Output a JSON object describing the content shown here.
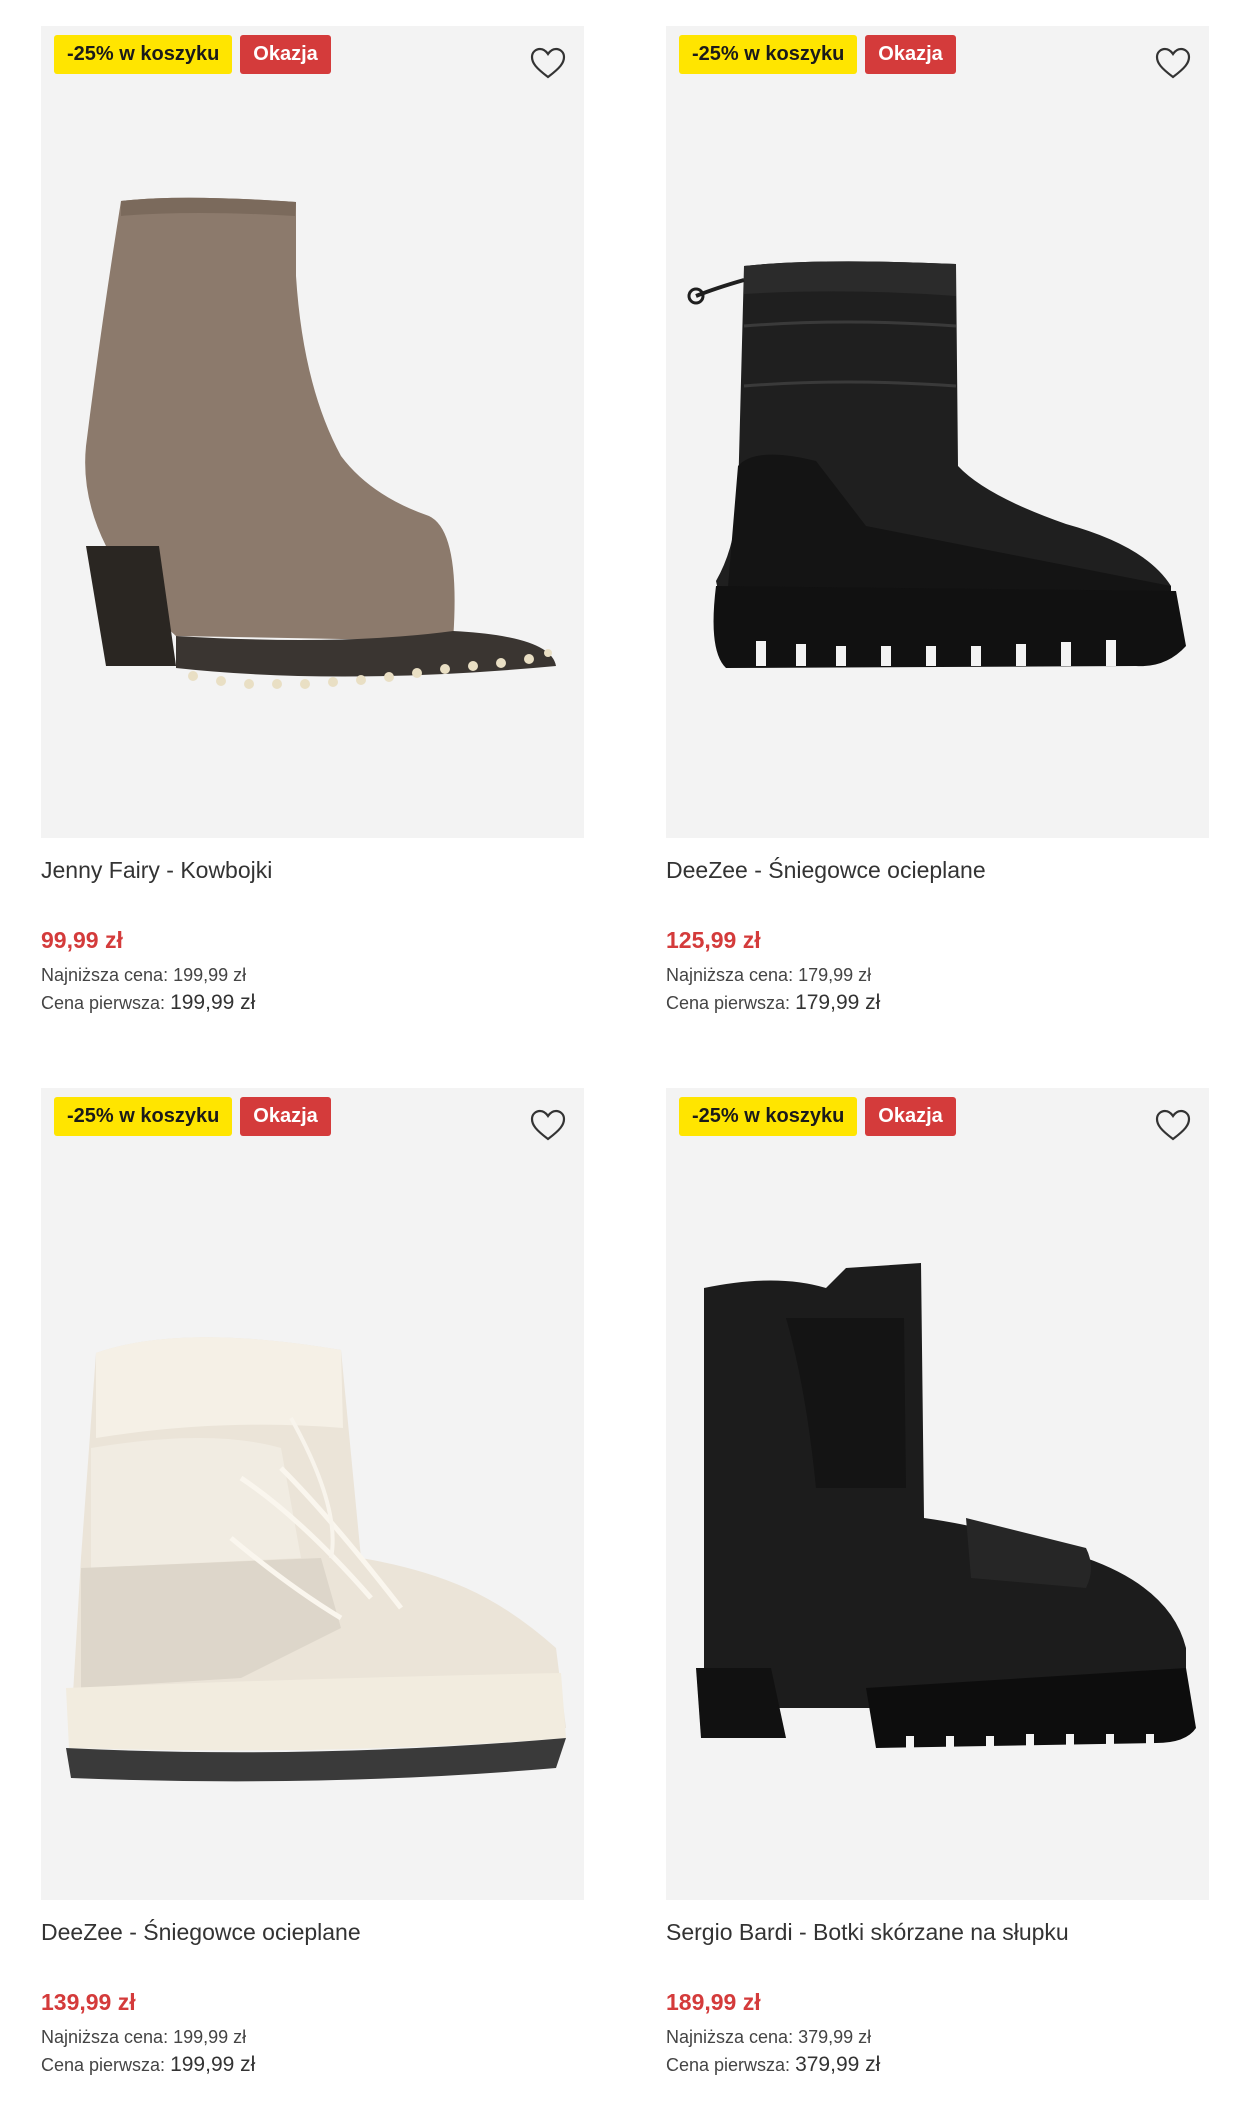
{
  "products": [
    {
      "badge_promo": "-25% w koszyku",
      "badge_deal": "Okazja",
      "name": "Jenny Fairy - Kowbojki",
      "price": "99,99 zł",
      "lowest_label": "Najniższa cena:",
      "lowest_value": "199,99 zł",
      "original_label": "Cena pierwsza:",
      "original_value": "199,99 zł",
      "image_icon": "taupe-cowboy-boot"
    },
    {
      "badge_promo": "-25% w koszyku",
      "badge_deal": "Okazja",
      "name": "DeeZee - Śniegowce ocieplane",
      "price": "125,99 zł",
      "lowest_label": "Najniższa cena:",
      "lowest_value": "179,99 zł",
      "original_label": "Cena pierwsza:",
      "original_value": "179,99 zł",
      "image_icon": "black-snow-boot"
    },
    {
      "badge_promo": "-25% w koszyku",
      "badge_deal": "Okazja",
      "name": "DeeZee - Śniegowce ocieplane",
      "price": "139,99 zł",
      "lowest_label": "Najniższa cena:",
      "lowest_value": "199,99 zł",
      "original_label": "Cena pierwsza:",
      "original_value": "199,99 zł",
      "image_icon": "white-snow-boot"
    },
    {
      "badge_promo": "-25% w koszyku",
      "badge_deal": "Okazja",
      "name": "Sergio Bardi - Botki skórzane na słupku",
      "price": "189,99 zł",
      "lowest_label": "Najniższa cena:",
      "lowest_value": "379,99 zł",
      "original_label": "Cena pierwsza:",
      "original_value": "379,99 zł",
      "image_icon": "black-leather-ankle-boot"
    }
  ],
  "colors": {
    "promo_badge": "#ffe500",
    "deal_badge": "#d43b3b",
    "price": "#d43b3b",
    "image_bg": "#f3f3f3"
  }
}
